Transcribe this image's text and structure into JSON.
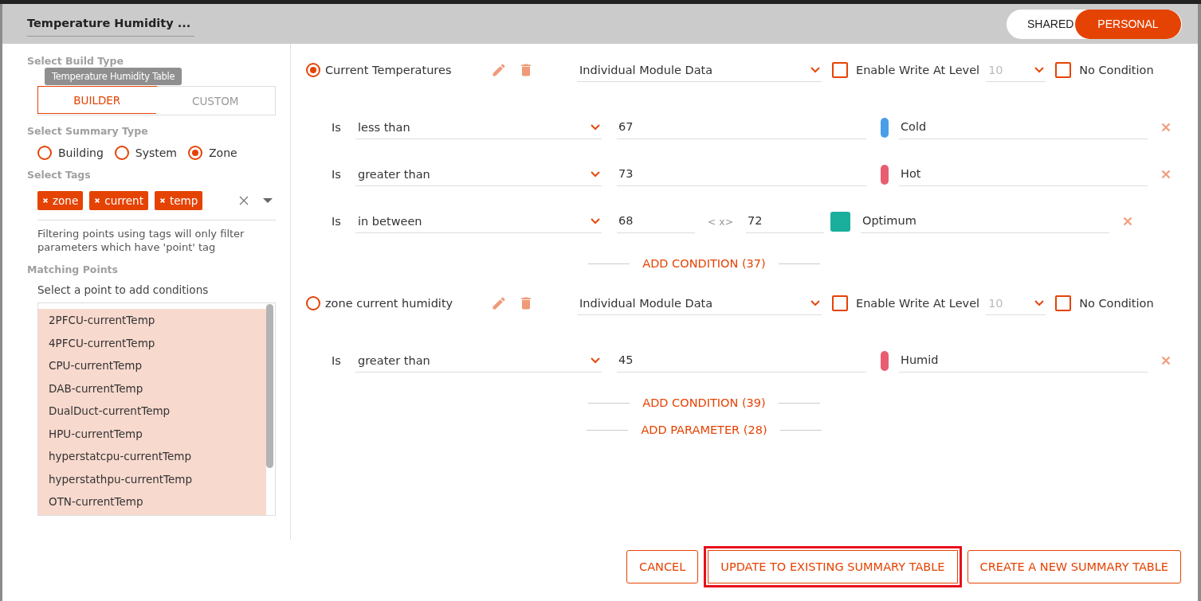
{
  "title": "Temperature Humidity ...",
  "tooltip": "Temperature Humidity Table",
  "scope_toggle": [
    {
      "label": "SHARED",
      "selected": false
    },
    {
      "label": "PERSONAL",
      "selected": true
    }
  ],
  "build_type": {
    "label": "Select Build Type",
    "tabs": [
      {
        "label": "BUILDER",
        "selected": true
      },
      {
        "label": "CUSTOM",
        "selected": false
      }
    ]
  },
  "summary_type": {
    "label": "Select Summary Type",
    "options": [
      {
        "label": "Building",
        "selected": false
      },
      {
        "label": "System",
        "selected": false
      },
      {
        "label": "Zone",
        "selected": true
      }
    ]
  },
  "tags": {
    "label": "Select Tags",
    "items": [
      {
        "label": "zone"
      },
      {
        "label": "current"
      },
      {
        "label": "temp"
      }
    ],
    "note": "Filtering points using tags will only filter parameters which have 'point' tag"
  },
  "matching_points": {
    "label": "Matching Points",
    "hint": "Select a point to add conditions",
    "items": [
      {
        "label": "2PFCU-currentTemp"
      },
      {
        "label": "4PFCU-currentTemp"
      },
      {
        "label": "CPU-currentTemp"
      },
      {
        "label": "DAB-currentTemp"
      },
      {
        "label": "DualDuct-currentTemp"
      },
      {
        "label": "HPU-currentTemp"
      },
      {
        "label": "hyperstatcpu-currentTemp"
      },
      {
        "label": "hyperstathpu-currentTemp"
      },
      {
        "label": "OTN-currentTemp"
      }
    ]
  },
  "parameters": [
    {
      "name": "Current Temperatures",
      "selected": true,
      "source": "Individual Module Data",
      "enable_write": {
        "label": "Enable Write At Level",
        "checked": false,
        "level": "10"
      },
      "no_condition": {
        "label": "No Condition",
        "checked": false
      },
      "conditions": [
        {
          "kind": "single",
          "is_label": "Is",
          "operator": "less than",
          "value": "67",
          "color": "#4a9de8",
          "label": "Cold"
        },
        {
          "kind": "single",
          "is_label": "Is",
          "operator": "greater than",
          "value": "73",
          "color": "#e85d6f",
          "label": "Hot"
        },
        {
          "kind": "range",
          "is_label": "Is",
          "operator": "in between",
          "value": "68",
          "separator": "< x>",
          "value_2": "72",
          "color": "#1aaf9c",
          "label": "Optimum"
        }
      ],
      "add_condition": "ADD CONDITION (37)"
    },
    {
      "name": "zone current humidity",
      "selected": false,
      "source": "Individual Module Data",
      "enable_write": {
        "label": "Enable Write At Level",
        "checked": false,
        "level": "10"
      },
      "no_condition": {
        "label": "No Condition",
        "checked": false
      },
      "conditions": [
        {
          "kind": "single",
          "is_label": "Is",
          "operator": "greater than",
          "value": "45",
          "color": "#e85d6f",
          "label": "Humid"
        }
      ],
      "add_condition": "ADD CONDITION (39)"
    }
  ],
  "add_parameter": "ADD PARAMETER (28)",
  "buttons": [
    {
      "label": "CANCEL",
      "kind": "outline"
    },
    {
      "label": "UPDATE TO EXISTING SUMMARY TABLE",
      "kind": "highlighted"
    },
    {
      "label": "CREATE A NEW SUMMARY TABLE",
      "kind": "outline"
    }
  ]
}
